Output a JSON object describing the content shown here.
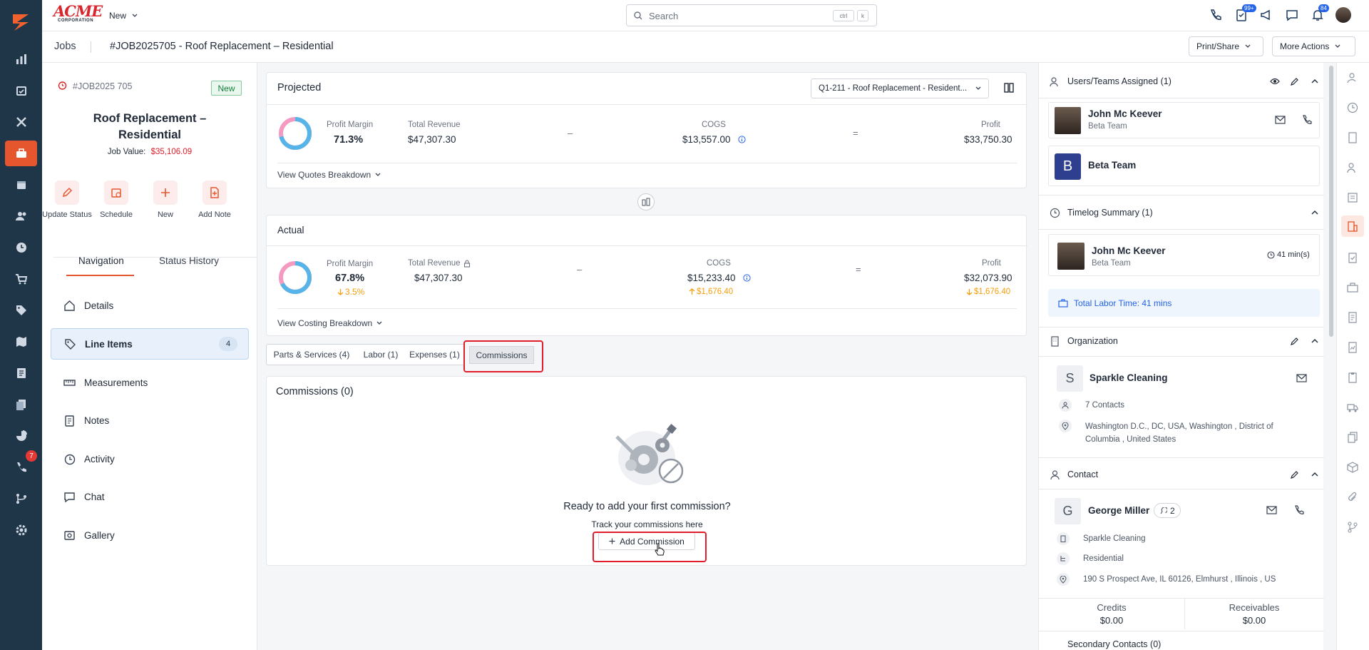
{
  "brand": {
    "name": "ACME",
    "sub": "CORPORATION"
  },
  "topbar": {
    "new_label": "New",
    "search_placeholder": "Search",
    "kbd1": "ctrl",
    "kbd2": "k",
    "badge_tasks": "99+",
    "badge_bell": "84"
  },
  "rail": {
    "badge": "7"
  },
  "breadcrumb": {
    "root": "Jobs",
    "current": "#JOB2025705 - Roof Replacement – Residential"
  },
  "actions": {
    "print_share": "Print/Share",
    "more_actions": "More Actions"
  },
  "job": {
    "id": "#JOB2025 705",
    "status": "New",
    "title_line1": "Roof Replacement –",
    "title_line2": "Residential",
    "value_label": "Job Value:",
    "value": "$35,106.09"
  },
  "quick_actions": [
    "Update Status",
    "Schedule",
    "New",
    "Add Note"
  ],
  "left_tabs": {
    "navigation": "Navigation",
    "status_history": "Status History"
  },
  "nav": [
    {
      "label": "Details"
    },
    {
      "label": "Line Items",
      "count": "4"
    },
    {
      "label": "Measurements"
    },
    {
      "label": "Notes"
    },
    {
      "label": "Activity"
    },
    {
      "label": "Chat"
    },
    {
      "label": "Gallery"
    }
  ],
  "projected": {
    "title": "Projected",
    "quote_select": "Q1-211 - Roof Replacement - Resident...",
    "profit_margin_label": "Profit Margin",
    "profit_margin": "71.3%",
    "total_revenue_label": "Total Revenue",
    "total_revenue": "$47,307.30",
    "minus": "–",
    "cogs_label": "COGS",
    "cogs": "$13,557.00",
    "equals": "=",
    "profit_label": "Profit",
    "profit": "$33,750.30",
    "breakdown": "View Quotes Breakdown",
    "margin_pct": 71.3
  },
  "actual": {
    "title": "Actual",
    "profit_margin_label": "Profit Margin",
    "profit_margin": "67.8%",
    "margin_delta": "3.5%",
    "total_revenue_label": "Total Revenue",
    "total_revenue": "$47,307.30",
    "minus": "–",
    "cogs_label": "COGS",
    "cogs": "$15,233.40",
    "cogs_delta": "$1,676.40",
    "equals": "=",
    "profit_label": "Profit",
    "profit": "$32,073.90",
    "profit_delta": "$1,676.40",
    "breakdown": "View Costing Breakdown",
    "margin_pct": 67.8
  },
  "tabs": [
    "Parts & Services (4)",
    "Labor (1)",
    "Expenses (1)",
    "Commissions"
  ],
  "commissions": {
    "title": "Commissions (0)",
    "empty_title": "Ready to add your first commission?",
    "empty_sub": "Track your commissions here",
    "add_button": "Add Commission"
  },
  "users_teams": {
    "title": "Users/Teams Assigned (1)",
    "user_name": "John Mc Keever",
    "user_team": "Beta Team",
    "team_initial": "B",
    "team_name": "Beta Team"
  },
  "timelog": {
    "title": "Timelog Summary (1)",
    "user_name": "John Mc Keever",
    "user_team": "Beta Team",
    "duration": "41 min(s)",
    "total": "Total Labor Time: 41 mins"
  },
  "organization": {
    "title": "Organization",
    "initial": "S",
    "name": "Sparkle Cleaning",
    "contacts": "7 Contacts",
    "address_line1": "Washington D.C., DC, USA, Washington , District of",
    "address_line2": "Columbia , United States"
  },
  "contact": {
    "title": "Contact",
    "initial": "G",
    "name": "George Miller",
    "count": "2",
    "org": "Sparkle Cleaning",
    "type": "Residential",
    "address": "190 S Prospect Ave, IL 60126, Elmhurst , Illinois , US",
    "credits_label": "Credits",
    "credits": "$0.00",
    "receivables_label": "Receivables",
    "receivables": "$0.00"
  },
  "secondary": {
    "title": "Secondary Contacts (0)"
  },
  "colors": {
    "accent": "#e5562f",
    "rail": "#1f3548",
    "link": "#2563eb",
    "danger": "#e11d2b",
    "warn": "#f59e0b"
  }
}
